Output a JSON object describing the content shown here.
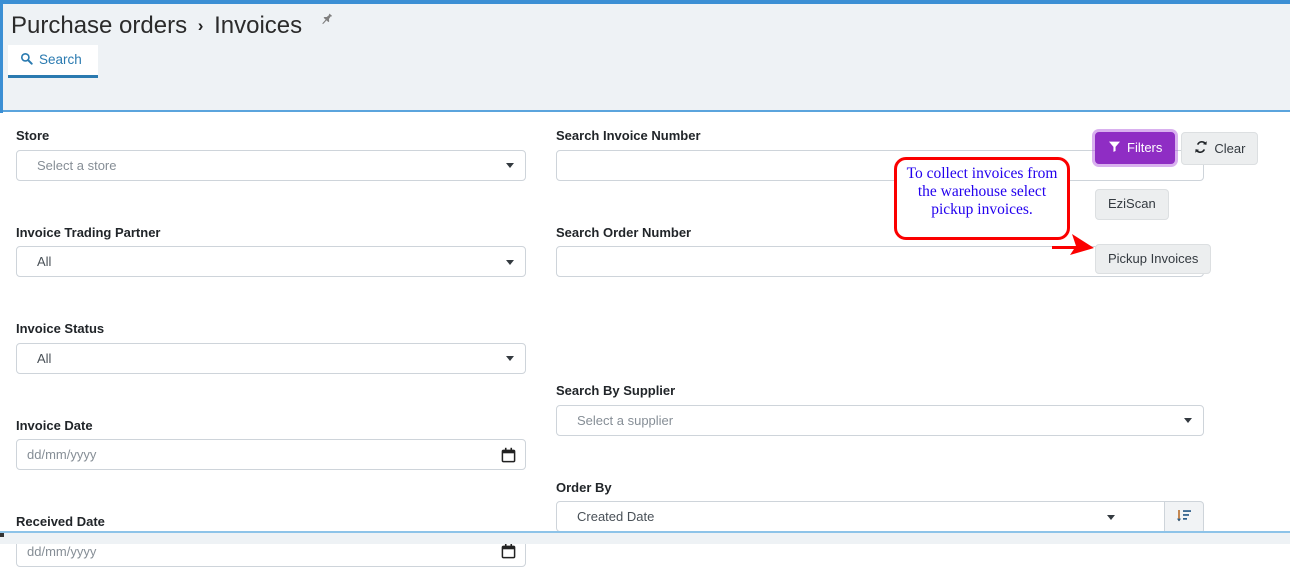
{
  "theme": {
    "accent_blue": "#3b8fd4",
    "tab_blue": "#2a7ab0",
    "header_band": "#eef2f5",
    "filters_purple": "#8f2dc4",
    "callout_border": "#fb0000",
    "callout_text": "#2200ee"
  },
  "header": {
    "breadcrumb": {
      "parent": "Purchase orders",
      "separator": "›",
      "current": "Invoices",
      "pin_icon": "pin-icon"
    },
    "tabs": [
      {
        "label": "Search",
        "icon": "search-icon",
        "active": true
      }
    ]
  },
  "form": {
    "left_column": [
      {
        "label": "Store",
        "type": "select",
        "value": "Select a store",
        "is_placeholder": true
      },
      {
        "label": "Invoice Trading Partner",
        "type": "select",
        "value": "All",
        "is_placeholder": false
      },
      {
        "label": "Invoice Status",
        "type": "select",
        "value": "All",
        "is_placeholder": false
      },
      {
        "label": "Invoice Date",
        "type": "date",
        "value": "",
        "placeholder": "dd/mm/yyyy"
      },
      {
        "label": "Received Date",
        "type": "date",
        "value": "",
        "placeholder": "dd/mm/yyyy"
      }
    ],
    "middle_column": [
      {
        "label": "Search Invoice Number",
        "type": "text",
        "value": "",
        "placeholder": ""
      },
      {
        "label": "Search Order Number",
        "type": "text",
        "value": "",
        "placeholder": ""
      },
      {
        "label": "Search By Supplier",
        "type": "select",
        "value": "Select a supplier",
        "is_placeholder": true
      },
      {
        "label": "Order By",
        "type": "select",
        "value": "Created Date",
        "is_placeholder": false
      }
    ],
    "sort_button": {
      "icon": "sort-descending-icon",
      "label": ""
    }
  },
  "actions": {
    "filters": {
      "label": "Filters",
      "icon": "funnel-icon"
    },
    "clear": {
      "label": "Clear",
      "icon": "refresh-icon"
    },
    "eziscan": {
      "label": "EziScan"
    },
    "pickup_invoices": {
      "label": "Pickup Invoices"
    }
  },
  "annotation": {
    "text": "To collect invoices from the warehouse select pickup invoices.",
    "points_to": "Pickup Invoices"
  }
}
